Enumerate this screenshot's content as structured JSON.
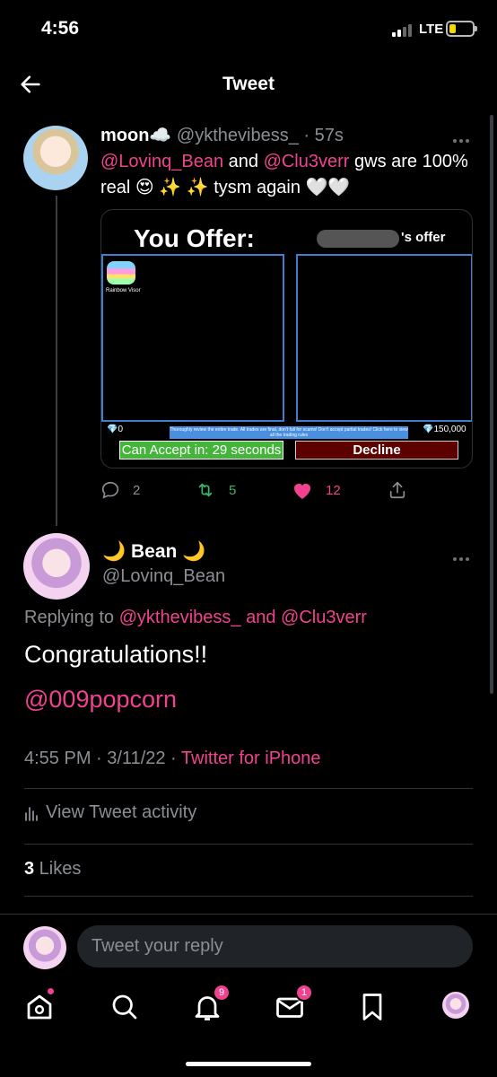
{
  "status_bar": {
    "time": "4:56",
    "network": "LTE",
    "battery_color": "#f5d800"
  },
  "nav": {
    "title": "Tweet",
    "back_icon": "arrow-left-icon"
  },
  "accent_color": "#f0428f",
  "tweet1": {
    "display_name": "moon☁️",
    "handle": "@ykthevibess_",
    "age": "· 57s",
    "mention1": "@Lovinq_Bean",
    "text_and": " and ",
    "mention2": "@Clu3verr",
    "text_rest": " gws are 100% real 😍 ✨ ✨  tysm again 🤍🤍",
    "embed": {
      "you_offer": "You Offer:",
      "their_offer": "'s offer",
      "item_label": "Rainbow Visor",
      "left_diamonds": "💎0",
      "warning": "Thoroughly review the entire trade. All trades are final, don't fall for scams! Don't accept partial trades! Click here to view all the trading rules",
      "right_diamonds": "💎150,000",
      "accept_label": "Can Accept in: 29 seconds",
      "decline_label": "Decline"
    },
    "actions": {
      "replies": "2",
      "retweets": "5",
      "likes": "12"
    }
  },
  "tweet2": {
    "display_name": "🌙 Bean 🌙",
    "handle": "@Lovinq_Bean",
    "replying_prefix": "Replying to ",
    "replying_to_1": "@ykthevibess_",
    "replying_and": " and ",
    "replying_to_2": "@Clu3verr",
    "text": "Congratulations!!",
    "mention": "@009popcorn",
    "timestamp": "4:55 PM · 3/11/22 · ",
    "source": "Twitter for iPhone",
    "activity_label": "View Tweet activity",
    "likes_count": "3",
    "likes_label": " Likes"
  },
  "reply": {
    "placeholder": "Tweet your reply"
  },
  "tab_bar": {
    "notifications_badge": "9",
    "messages_badge": "1",
    "icons": [
      "home-icon",
      "search-icon",
      "bell-icon",
      "mail-icon",
      "bookmark-icon",
      "profile-avatar"
    ]
  }
}
